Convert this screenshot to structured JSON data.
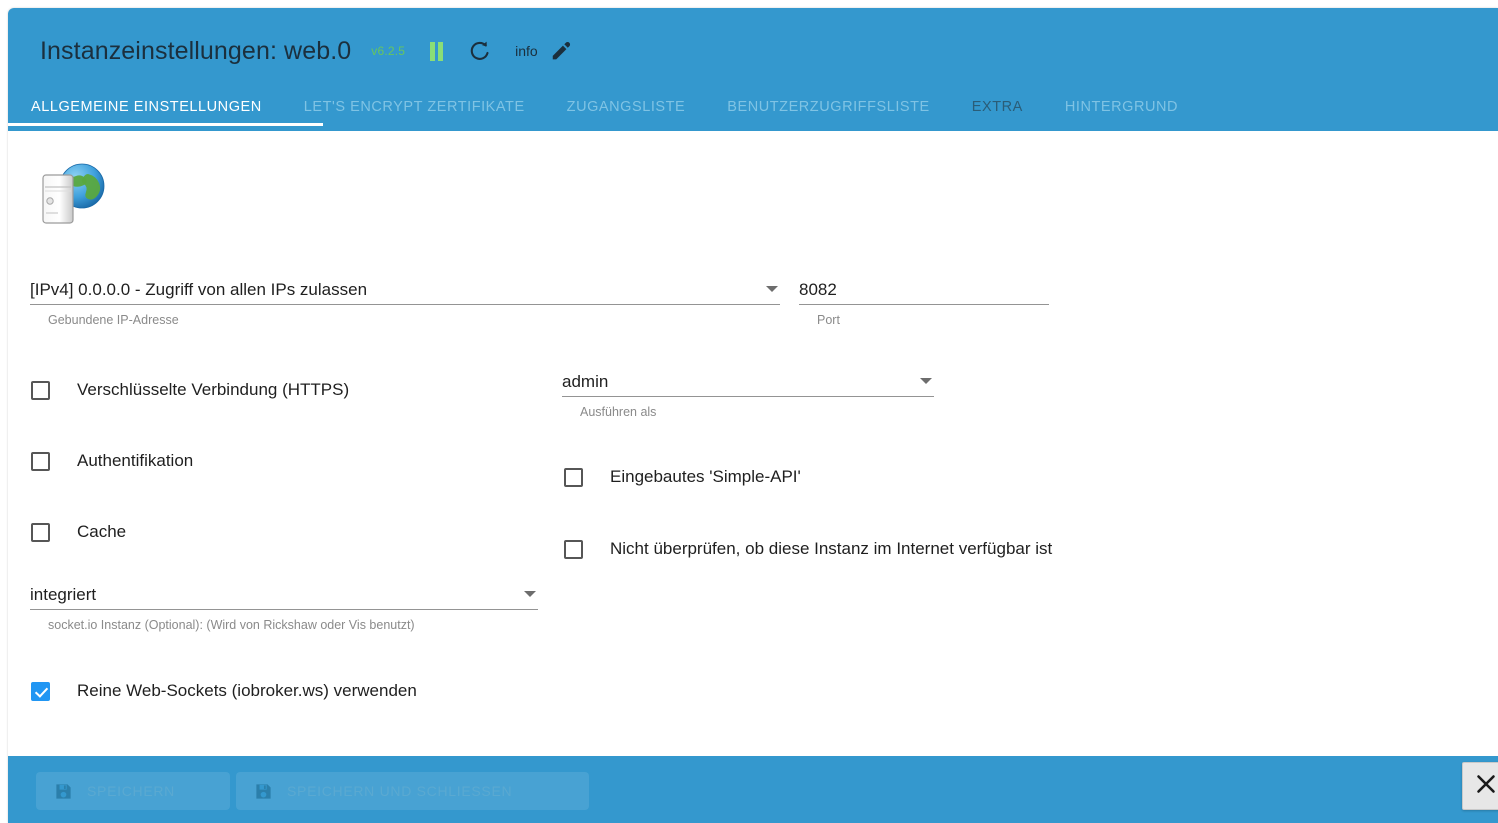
{
  "header": {
    "title": "Instanzeinstellungen: web.0",
    "version": "v6.2.5",
    "pause_icon": "pause-icon",
    "restart_icon": "refresh-icon",
    "info_label": "info",
    "edit_icon": "pencil-icon",
    "background_color": "#3498ce",
    "version_color": "#66c65e"
  },
  "tabs": [
    {
      "label": "ALLGEMEINE EINSTELLUNGEN",
      "state": "active"
    },
    {
      "label": "LET'S ENCRYPT ZERTIFIKATE",
      "state": "inactive"
    },
    {
      "label": "ZUGANGSLISTE",
      "state": "inactive"
    },
    {
      "label": "BENUTZERZUGRIFFSLISTE",
      "state": "inactive"
    },
    {
      "label": "EXTRA",
      "state": "semi"
    },
    {
      "label": "HINTERGRUND",
      "state": "inactive"
    }
  ],
  "form": {
    "adapter_icon": "web-adapter-icon",
    "bind_ip": {
      "value": "[IPv4] 0.0.0.0 - Zugriff von allen IPs zulassen",
      "helper": "Gebundene IP-Adresse",
      "dropdown_icon": "chevron-down-icon"
    },
    "port": {
      "value": "8082",
      "helper": "Port"
    },
    "run_as": {
      "value": "admin",
      "helper": "Ausführen als",
      "dropdown_icon": "chevron-down-icon"
    },
    "socketio": {
      "value": "integriert",
      "helper": "socket.io Instanz (Optional): (Wird von Rickshaw oder Vis benutzt)",
      "dropdown_icon": "chevron-down-icon"
    },
    "checkboxes": {
      "https": {
        "label": "Verschlüsselte Verbindung (HTTPS)",
        "checked": false
      },
      "auth": {
        "label": "Authentifikation",
        "checked": false
      },
      "cache": {
        "label": "Cache",
        "checked": false
      },
      "simple_api": {
        "label": "Eingebautes 'Simple-API'",
        "checked": false
      },
      "no_internet_check": {
        "label": "Nicht überprüfen, ob diese Instanz im Internet verfügbar ist",
        "checked": false
      },
      "pure_websockets": {
        "label": "Reine Web-Sockets (iobroker.ws) verwenden",
        "checked": true
      }
    }
  },
  "footer": {
    "save_label": "SPEICHERN",
    "save_close_label": "SPEICHERN UND SCHLIESSEN",
    "save_icon": "floppy-disk-icon",
    "buttons_disabled": true,
    "background_color": "#3498ce"
  },
  "close_button": {
    "icon": "close-icon"
  }
}
